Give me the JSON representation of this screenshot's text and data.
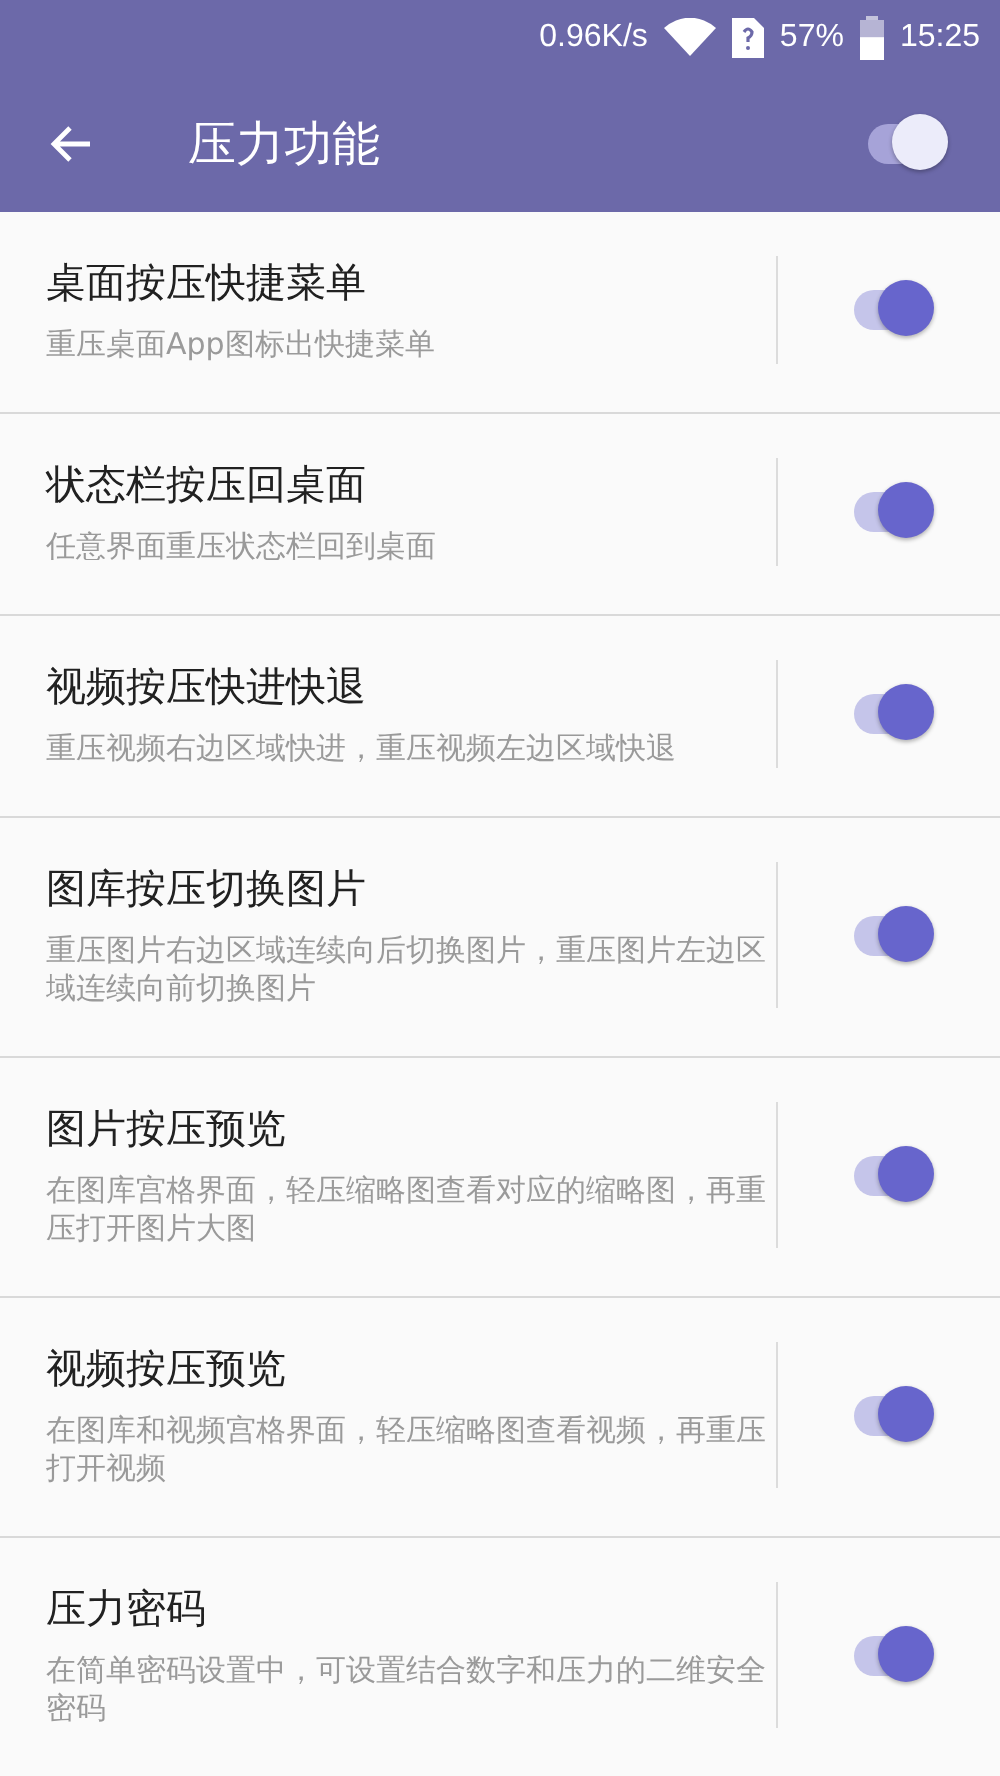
{
  "status_bar": {
    "speed": "0.96K/s",
    "battery_percent": "57%",
    "time": "15:25"
  },
  "toolbar": {
    "title": "压力功能",
    "master_on": true
  },
  "items": [
    {
      "title": "桌面按压快捷菜单",
      "description": "重压桌面App图标出快捷菜单",
      "on": true
    },
    {
      "title": "状态栏按压回桌面",
      "description": "任意界面重压状态栏回到桌面",
      "on": true
    },
    {
      "title": "视频按压快进快退",
      "description": "重压视频右边区域快进，重压视频左边区域快退",
      "on": true
    },
    {
      "title": "图库按压切换图片",
      "description": "重压图片右边区域连续向后切换图片，重压图片左边区域连续向前切换图片",
      "on": true
    },
    {
      "title": "图片按压预览",
      "description": "在图库宫格界面，轻压缩略图查看对应的缩略图，再重压打开图片大图",
      "on": true
    },
    {
      "title": "视频按压预览",
      "description": "在图库和视频宫格界面，轻压缩略图查看视频，再重压打开视频",
      "on": true
    },
    {
      "title": "压力密码",
      "description": "在简单密码设置中，可设置结合数字和压力的二维安全密码",
      "on": true
    }
  ]
}
